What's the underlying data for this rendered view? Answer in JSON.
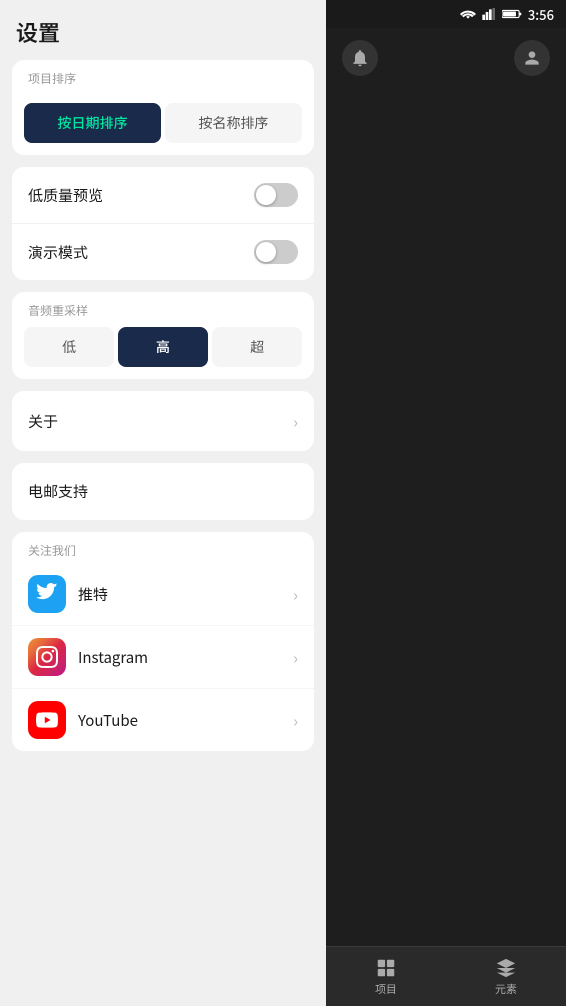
{
  "statusBar": {
    "time": "3:56"
  },
  "settings": {
    "title": "设置",
    "sortSection": {
      "label": "项目排序",
      "buttons": [
        {
          "id": "by-date",
          "label": "按日期排序",
          "active": true
        },
        {
          "id": "by-name",
          "label": "按名称排序",
          "active": false
        }
      ]
    },
    "toggleSection": {
      "items": [
        {
          "id": "low-quality",
          "label": "低质量预览",
          "enabled": false
        },
        {
          "id": "demo-mode",
          "label": "演示模式",
          "enabled": false
        }
      ]
    },
    "audioSection": {
      "label": "音频重采样",
      "buttons": [
        {
          "id": "low",
          "label": "低",
          "active": false
        },
        {
          "id": "high",
          "label": "高",
          "active": true
        },
        {
          "id": "super",
          "label": "超",
          "active": false
        }
      ]
    },
    "aboutItem": {
      "label": "关于"
    },
    "emailItem": {
      "label": "电邮支持"
    },
    "followSection": {
      "label": "关注我们",
      "items": [
        {
          "id": "twitter",
          "label": "推特",
          "icon": "twitter"
        },
        {
          "id": "instagram",
          "label": "Instagram",
          "icon": "instagram"
        },
        {
          "id": "youtube",
          "label": "YouTube",
          "icon": "youtube"
        }
      ]
    }
  },
  "rightPanel": {
    "bottomNav": [
      {
        "id": "projects",
        "label": "项目"
      },
      {
        "id": "elements",
        "label": "元素"
      }
    ]
  }
}
